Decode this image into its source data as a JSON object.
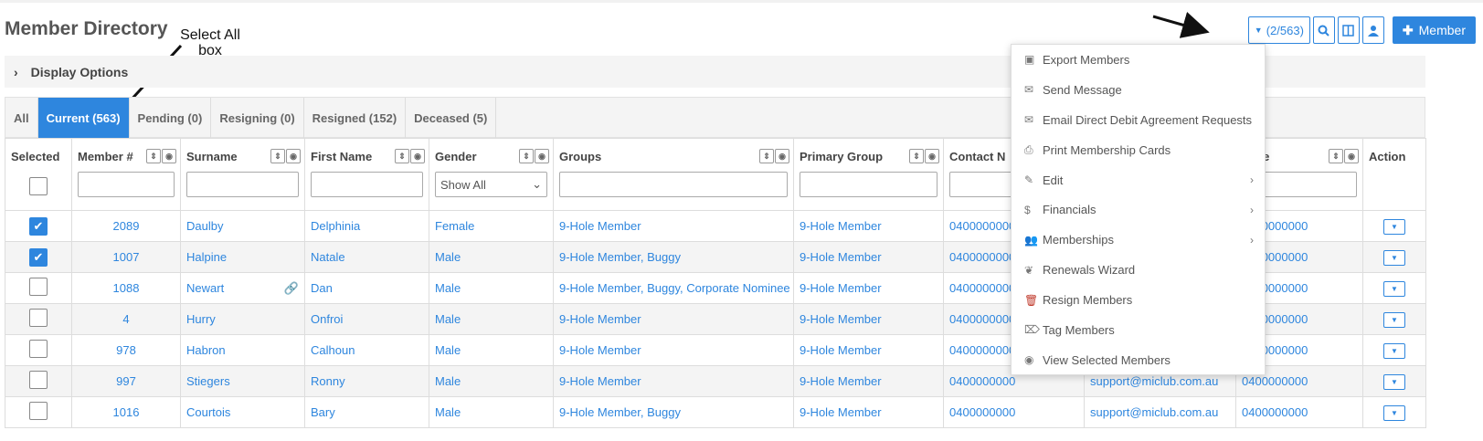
{
  "page": {
    "title": "Member Directory"
  },
  "annotation": {
    "select_all": "Select All box"
  },
  "toolbar": {
    "selection_count": "(2/563)",
    "add_member_label": "Member",
    "icons": [
      "search-icon",
      "columns-icon",
      "user-icon"
    ]
  },
  "display_options": {
    "label": "Display Options"
  },
  "tabs": [
    {
      "label": "All",
      "active": false
    },
    {
      "label": "Current (563)",
      "active": true
    },
    {
      "label": "Pending (0)",
      "active": false
    },
    {
      "label": "Resigning (0)",
      "active": false
    },
    {
      "label": "Resigned (152)",
      "active": false
    },
    {
      "label": "Deceased (5)",
      "active": false
    }
  ],
  "table": {
    "headers": {
      "selected": "Selected",
      "member_no": "Member #",
      "surname": "Surname",
      "first_name": "First Name",
      "gender": "Gender",
      "groups": "Groups",
      "primary_group": "Primary Group",
      "contact": "Contact N",
      "email": "",
      "mobile": "obile",
      "action": "Action"
    },
    "gender_filter": "Show All",
    "rows": [
      {
        "checked": true,
        "member_no": "2089",
        "surname": "Daulby",
        "first_name": "Delphinia",
        "gender": "Female",
        "groups": "9-Hole Member",
        "primary_group": "9-Hole Member",
        "contact": "0400000000",
        "email": "",
        "mobile": "0400000000"
      },
      {
        "checked": true,
        "member_no": "1007",
        "surname": "Halpine",
        "first_name": "Natale",
        "gender": "Male",
        "groups": "9-Hole Member, Buggy",
        "primary_group": "9-Hole Member",
        "contact": "0400000000",
        "email": "",
        "mobile": "0400000000"
      },
      {
        "checked": false,
        "member_no": "1088",
        "surname": "Newart",
        "first_name": "Dan",
        "gender": "Male",
        "groups": "9-Hole Member, Buggy, Corporate Nominee",
        "primary_group": "9-Hole Member",
        "contact": "0400000000",
        "email": "",
        "mobile": "0400000000"
      },
      {
        "checked": false,
        "member_no": "4",
        "surname": "Hurry",
        "first_name": "Onfroi",
        "gender": "Male",
        "groups": "9-Hole Member",
        "primary_group": "9-Hole Member",
        "contact": "0400000000",
        "email": "",
        "mobile": "0400000000"
      },
      {
        "checked": false,
        "member_no": "978",
        "surname": "Habron",
        "first_name": "Calhoun",
        "gender": "Male",
        "groups": "9-Hole Member",
        "primary_group": "9-Hole Member",
        "contact": "0400000000",
        "email": "",
        "mobile": "0400000000"
      },
      {
        "checked": false,
        "member_no": "997",
        "surname": "Stiegers",
        "first_name": "Ronny",
        "gender": "Male",
        "groups": "9-Hole Member",
        "primary_group": "9-Hole Member",
        "contact": "0400000000",
        "email": "support@miclub.com.au",
        "mobile": "0400000000"
      },
      {
        "checked": false,
        "member_no": "1016",
        "surname": "Courtois",
        "first_name": "Bary",
        "gender": "Male",
        "groups": "9-Hole Member, Buggy",
        "primary_group": "9-Hole Member",
        "contact": "0400000000",
        "email": "support@miclub.com.au",
        "mobile": "0400000000"
      }
    ]
  },
  "dropdown": {
    "items": [
      {
        "label": "Export Members",
        "icon": "excel-icon",
        "submenu": false
      },
      {
        "label": "Send Message",
        "icon": "envelope-icon",
        "submenu": false
      },
      {
        "label": "Email Direct Debit Agreement Requests",
        "icon": "envelope-icon",
        "submenu": false
      },
      {
        "label": "Print Membership Cards",
        "icon": "print-icon",
        "submenu": false
      },
      {
        "label": "Edit",
        "icon": "pencil-icon",
        "submenu": true
      },
      {
        "label": "Financials",
        "icon": "dollar-icon",
        "submenu": true
      },
      {
        "label": "Memberships",
        "icon": "users-icon",
        "submenu": true
      },
      {
        "label": "Renewals Wizard",
        "icon": "leaf-icon",
        "submenu": false
      },
      {
        "label": "Resign Members",
        "icon": "trash-icon",
        "submenu": false
      },
      {
        "label": "Tag Members",
        "icon": "tag-icon",
        "submenu": false
      },
      {
        "label": "View Selected Members",
        "icon": "eye-icon",
        "submenu": false
      }
    ]
  },
  "colors": {
    "accent": "#2e86de",
    "stripe": "#f4f4f4",
    "trash": "#c0392b"
  }
}
